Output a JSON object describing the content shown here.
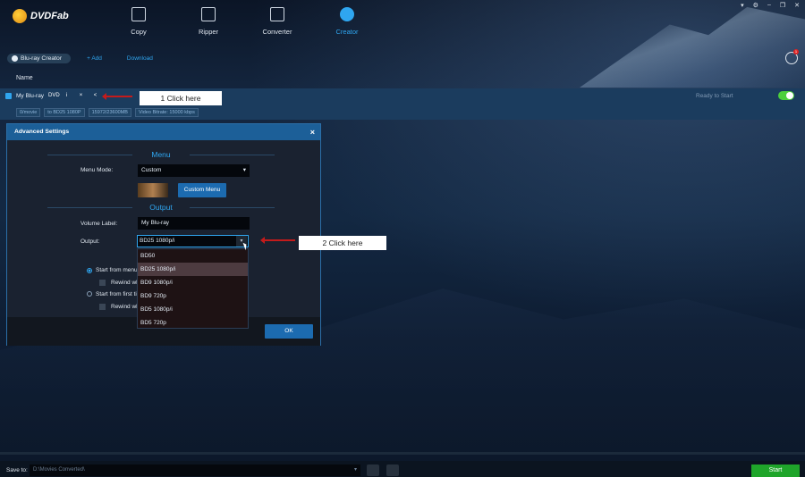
{
  "app": {
    "logo_text": "DVDFab"
  },
  "nav": [
    {
      "label": "Copy",
      "icon": "copy-icon"
    },
    {
      "label": "Ripper",
      "icon": "ripper-icon"
    },
    {
      "label": "Converter",
      "icon": "converter-icon"
    },
    {
      "label": "Creator",
      "icon": "creator-icon",
      "active": true
    }
  ],
  "toolbar": {
    "mode_label": "Blu-ray Creator",
    "add_label": "+ Add",
    "download_label": "Download",
    "queue_badge": "1"
  },
  "list": {
    "column_name": "Name",
    "task": {
      "name": "My Blu-ray",
      "icons": [
        "DVD",
        "i",
        "×",
        "<"
      ],
      "tags": [
        "0/movie",
        "to BD25 1080P",
        "15972/23600MB",
        "Video Bitrate: 15000 kbps"
      ],
      "status": "Ready to Start"
    }
  },
  "callouts": {
    "first": "1  Click here",
    "second": "2 Click here"
  },
  "dialog": {
    "title": "Advanced Settings",
    "close": "×",
    "menu_section": "Menu",
    "menu_mode_label": "Menu Mode:",
    "menu_mode_value": "Custom",
    "custom_menu_button": "Custom Menu",
    "output_section": "Output",
    "volume_label_label": "Volume Label:",
    "volume_label_value": "My Blu-ray",
    "output_label": "Output:",
    "output_value": "BD25 1080p/i",
    "output_options": [
      "BD50",
      "BD25 1080p/i",
      "BD9 1080p/i",
      "BD9 720p",
      "BD5 1080p/i",
      "BD5 720p"
    ],
    "start_from_menu": "Start from menu",
    "rewind_1": "Rewind wh",
    "start_from_first": "Start from first tit",
    "rewind_2": "Rewind wh",
    "ok_button": "OK"
  },
  "bottom": {
    "save_to_label": "Save to:",
    "save_path": "D:\\Movies Converted\\",
    "start_button": "Start"
  },
  "colors": {
    "accent": "#2fa6f0",
    "start": "#1fa52a",
    "arrow": "#c41b1b",
    "toggle": "#4ccf3c"
  }
}
